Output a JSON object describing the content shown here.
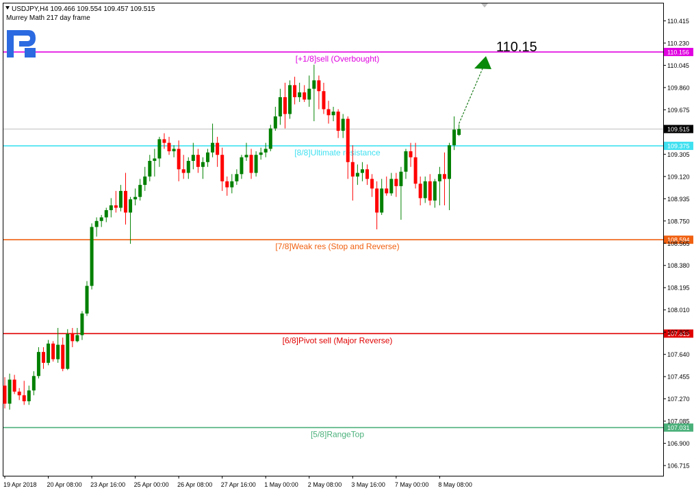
{
  "header": {
    "symbol_line": "USDJPY,H4  109.466 109.554 109.457 109.515",
    "indicator": "Murrey Math 217 day frame"
  },
  "target_label": "110.15",
  "chart_data": {
    "type": "candlestick",
    "symbol": "USDJPY",
    "timeframe": "H4",
    "ylim": [
      106.63,
      110.56
    ],
    "current_price": "109.515",
    "y_ticks": [
      "110.415",
      "110.230",
      "110.045",
      "109.860",
      "109.675",
      "109.305",
      "109.120",
      "108.935",
      "108.750",
      "108.565",
      "108.380",
      "108.195",
      "108.010",
      "107.825",
      "107.640",
      "107.455",
      "107.270",
      "107.085",
      "106.900",
      "106.715"
    ],
    "x_labels": [
      {
        "label": "19 Apr 2018",
        "index": 0
      },
      {
        "label": "20 Apr 08:00",
        "index": 9
      },
      {
        "label": "23 Apr 16:00",
        "index": 18
      },
      {
        "label": "25 Apr 00:00",
        "index": 27
      },
      {
        "label": "26 Apr 08:00",
        "index": 36
      },
      {
        "label": "27 Apr 16:00",
        "index": 45
      },
      {
        "label": "1 May 00:00",
        "index": 54
      },
      {
        "label": "2 May 08:00",
        "index": 63
      },
      {
        "label": "3 May 16:00",
        "index": 72
      },
      {
        "label": "7 May 00:00",
        "index": 81
      },
      {
        "label": "8 May 08:00",
        "index": 90
      }
    ],
    "levels": [
      {
        "name": "[+1/8]sell (Overbought)",
        "price": "110.156",
        "color": "#e000e0"
      },
      {
        "name": "[8/8]Ultimate resistance",
        "price": "109.375",
        "color": "#3fe0f0"
      },
      {
        "name": "[7/8]Weak res (Stop and Reverse)",
        "price": "108.594",
        "color": "#f06010"
      },
      {
        "name": "[6/8]Pivot sell (Major Reverse)",
        "price": "107.813",
        "color": "#e00000"
      },
      {
        "name": "[5/8]RangeTop",
        "price": "107.031",
        "color": "#4ab07a"
      }
    ],
    "candles": [
      [
        107.38,
        107.45,
        107.19,
        107.23
      ],
      [
        107.23,
        107.48,
        107.18,
        107.43
      ],
      [
        107.43,
        107.47,
        107.31,
        107.33
      ],
      [
        107.33,
        107.36,
        107.26,
        107.3
      ],
      [
        107.3,
        107.42,
        107.22,
        107.25
      ],
      [
        107.25,
        107.38,
        107.22,
        107.34
      ],
      [
        107.34,
        107.5,
        107.3,
        107.46
      ],
      [
        107.46,
        107.7,
        107.44,
        107.66
      ],
      [
        107.66,
        107.7,
        107.52,
        107.57
      ],
      [
        107.57,
        107.76,
        107.55,
        107.73
      ],
      [
        107.73,
        107.75,
        107.58,
        107.6
      ],
      [
        107.6,
        107.86,
        107.57,
        107.72
      ],
      [
        107.72,
        107.78,
        107.5,
        107.52
      ],
      [
        107.52,
        107.85,
        107.51,
        107.81
      ],
      [
        107.81,
        107.86,
        107.7,
        107.75
      ],
      [
        107.75,
        107.86,
        107.74,
        107.8
      ],
      [
        107.8,
        108.0,
        107.76,
        107.98
      ],
      [
        107.98,
        108.25,
        107.96,
        108.21
      ],
      [
        108.21,
        108.73,
        108.18,
        108.7
      ],
      [
        108.7,
        108.78,
        108.62,
        108.75
      ],
      [
        108.75,
        108.8,
        108.7,
        108.78
      ],
      [
        108.78,
        108.86,
        108.74,
        108.84
      ],
      [
        108.84,
        108.94,
        108.78,
        108.88
      ],
      [
        108.88,
        109.0,
        108.82,
        108.86
      ],
      [
        108.86,
        109.05,
        108.83,
        109.0
      ],
      [
        109.0,
        109.15,
        108.72,
        108.82
      ],
      [
        108.82,
        108.95,
        108.56,
        108.93
      ],
      [
        108.93,
        109.02,
        108.88,
        108.95
      ],
      [
        108.95,
        109.1,
        108.92,
        109.05
      ],
      [
        109.05,
        109.2,
        109.0,
        109.12
      ],
      [
        109.12,
        109.3,
        109.08,
        109.25
      ],
      [
        109.25,
        109.35,
        109.12,
        109.27
      ],
      [
        109.27,
        109.45,
        109.2,
        109.43
      ],
      [
        109.43,
        109.48,
        109.35,
        109.4
      ],
      [
        109.4,
        109.45,
        109.3,
        109.33
      ],
      [
        109.33,
        109.38,
        109.28,
        109.35
      ],
      [
        109.35,
        109.42,
        109.08,
        109.18
      ],
      [
        109.18,
        109.3,
        109.1,
        109.15
      ],
      [
        109.15,
        109.28,
        109.1,
        109.25
      ],
      [
        109.25,
        109.4,
        109.18,
        109.3
      ],
      [
        109.3,
        109.35,
        109.15,
        109.2
      ],
      [
        109.2,
        109.28,
        109.1,
        109.24
      ],
      [
        109.24,
        109.35,
        109.2,
        109.32
      ],
      [
        109.32,
        109.56,
        109.28,
        109.4
      ],
      [
        109.4,
        109.45,
        109.2,
        109.3
      ],
      [
        109.3,
        109.36,
        109.0,
        109.08
      ],
      [
        109.08,
        109.12,
        108.96,
        109.03
      ],
      [
        109.03,
        109.14,
        108.98,
        109.08
      ],
      [
        109.08,
        109.18,
        109.05,
        109.14
      ],
      [
        109.14,
        109.3,
        109.1,
        109.28
      ],
      [
        109.28,
        109.4,
        109.25,
        109.3
      ],
      [
        109.3,
        109.35,
        109.1,
        109.15
      ],
      [
        109.15,
        109.33,
        109.12,
        109.3
      ],
      [
        109.3,
        109.36,
        109.26,
        109.32
      ],
      [
        109.32,
        109.4,
        109.28,
        109.35
      ],
      [
        109.35,
        109.55,
        109.33,
        109.52
      ],
      [
        109.52,
        109.7,
        109.5,
        109.62
      ],
      [
        109.62,
        109.85,
        109.55,
        109.78
      ],
      [
        109.78,
        109.9,
        109.52,
        109.64
      ],
      [
        109.64,
        109.92,
        109.6,
        109.88
      ],
      [
        109.88,
        109.95,
        109.72,
        109.78
      ],
      [
        109.78,
        109.9,
        109.74,
        109.82
      ],
      [
        109.82,
        109.88,
        109.74,
        109.76
      ],
      [
        109.76,
        109.96,
        109.7,
        109.85
      ],
      [
        109.85,
        110.05,
        109.58,
        109.92
      ],
      [
        109.92,
        109.96,
        109.68,
        109.83
      ],
      [
        109.83,
        109.9,
        109.64,
        109.68
      ],
      [
        109.68,
        109.75,
        109.56,
        109.63
      ],
      [
        109.63,
        109.7,
        109.58,
        109.66
      ],
      [
        109.66,
        109.68,
        109.44,
        109.5
      ],
      [
        109.5,
        109.64,
        109.44,
        109.6
      ],
      [
        109.6,
        109.62,
        109.1,
        109.24
      ],
      [
        109.24,
        109.38,
        108.92,
        109.12
      ],
      [
        109.12,
        109.22,
        109.05,
        109.15
      ],
      [
        109.15,
        109.24,
        109.08,
        109.18
      ],
      [
        109.18,
        109.22,
        109.05,
        109.1
      ],
      [
        109.1,
        109.14,
        108.95,
        109.02
      ],
      [
        109.02,
        109.08,
        108.68,
        108.82
      ],
      [
        108.82,
        109.1,
        108.8,
        109.02
      ],
      [
        109.02,
        109.12,
        108.96,
        108.98
      ],
      [
        108.98,
        109.15,
        108.96,
        109.1
      ],
      [
        109.1,
        109.15,
        108.95,
        109.04
      ],
      [
        109.04,
        109.2,
        108.76,
        109.16
      ],
      [
        109.16,
        109.35,
        109.1,
        109.33
      ],
      [
        109.33,
        109.4,
        109.2,
        109.28
      ],
      [
        109.28,
        109.4,
        109.02,
        109.06
      ],
      [
        109.06,
        109.12,
        108.88,
        108.94
      ],
      [
        108.94,
        109.12,
        108.9,
        109.08
      ],
      [
        109.08,
        109.14,
        108.88,
        108.92
      ],
      [
        108.92,
        109.1,
        108.86,
        109.08
      ],
      [
        109.08,
        109.2,
        108.88,
        109.14
      ],
      [
        109.14,
        109.32,
        108.88,
        109.1
      ],
      [
        109.1,
        109.4,
        108.84,
        109.38
      ],
      [
        109.38,
        109.62,
        109.34,
        109.51
      ],
      [
        109.466,
        109.554,
        109.457,
        109.515
      ]
    ]
  }
}
